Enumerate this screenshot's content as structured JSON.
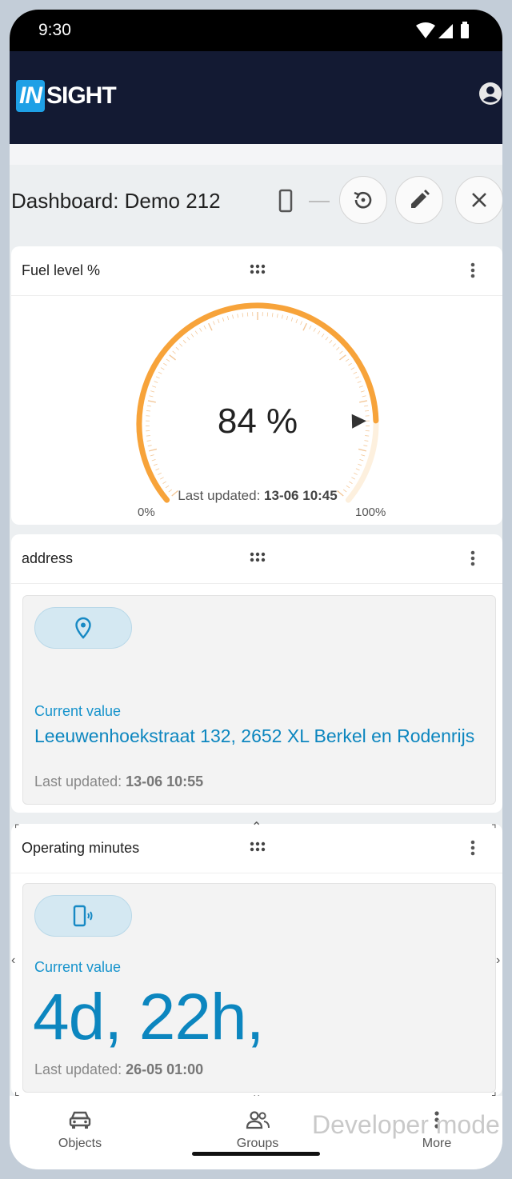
{
  "status_bar": {
    "time": "9:30"
  },
  "app_bar": {
    "logo_in": "IN",
    "logo_sight": "SIGHT"
  },
  "dashboard": {
    "title": "Dashboard: Demo 212"
  },
  "fuel_card": {
    "title": "Fuel level %",
    "value_text": "84 %",
    "value": 84,
    "min_label": "0%",
    "max_label": "100%",
    "updated_label": "Last updated:",
    "updated_value": "13-06 10:45",
    "colors": {
      "fill": "#f7a33a",
      "track": "#fdf0de",
      "ticks": "#f3c89a"
    }
  },
  "address_card": {
    "title": "address",
    "current_label": "Current value",
    "address": "Leeuwenhoekstraat 132, 2652 XL Berkel en Rodenrijs",
    "updated_label": "Last updated:",
    "updated_value": "13-06 10:55"
  },
  "operating_card": {
    "title": "Operating minutes",
    "current_label": "Current value",
    "value": "4d, 22h,",
    "updated_label": "Last updated:",
    "updated_value": "26-05 01:00"
  },
  "bottom_nav": {
    "items": [
      {
        "label": "Objects"
      },
      {
        "label": "Groups"
      },
      {
        "label": "More"
      }
    ],
    "watermark": "Developer mode"
  },
  "colors": {
    "app_bar": "#131a33",
    "accent": "#0c86bf",
    "logo_blue": "#1ea0e6"
  }
}
